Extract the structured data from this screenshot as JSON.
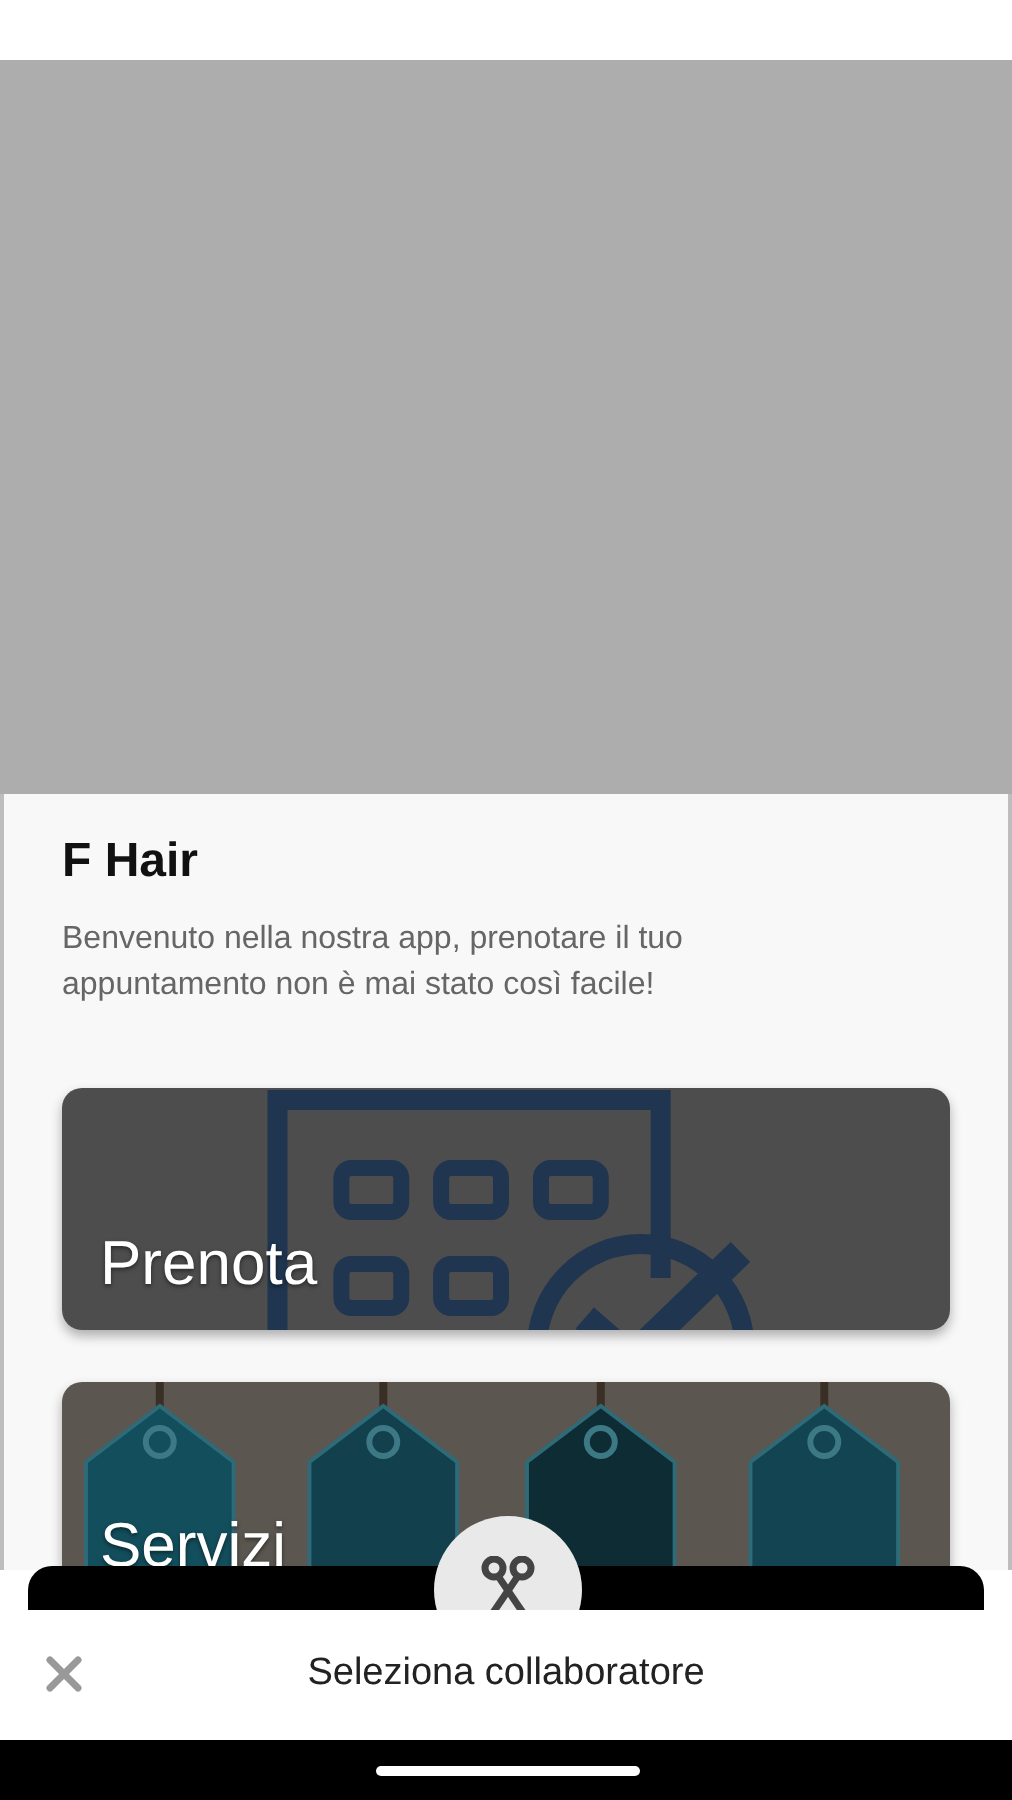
{
  "title": "F Hair",
  "description": "Benvenuto nella nostra app, prenotare il tuo appuntamento non è mai stato così facile!",
  "cards": [
    {
      "label": "Prenota",
      "kind": "calendar"
    },
    {
      "label": "Servizi",
      "kind": "tags"
    }
  ],
  "bottom_sheet": {
    "title": "Seleziona collaboratore"
  }
}
